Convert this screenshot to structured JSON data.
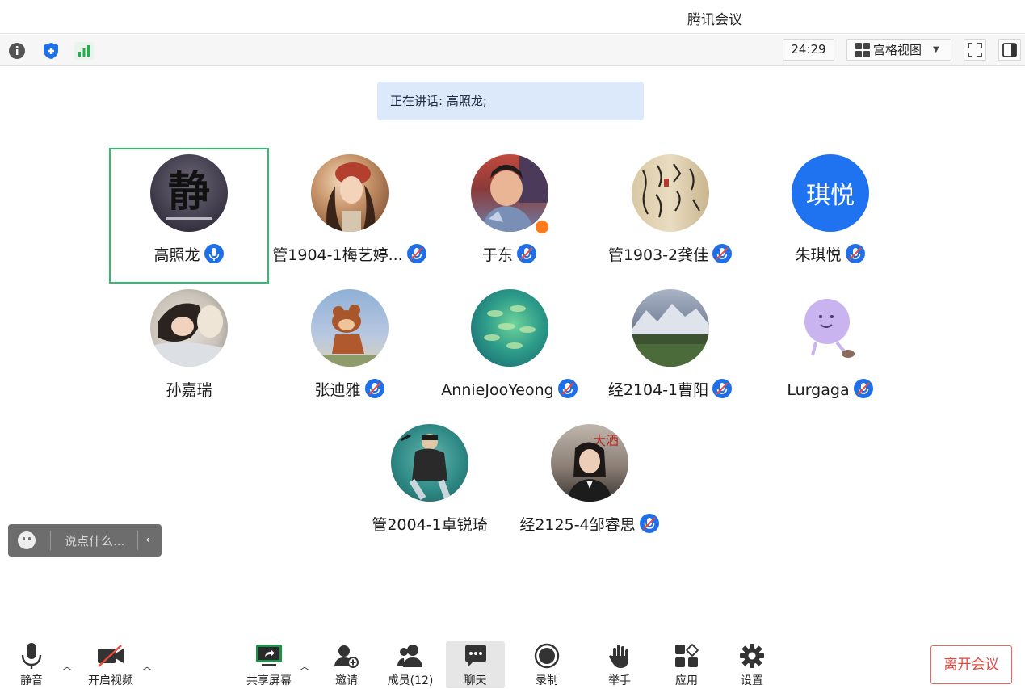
{
  "app": {
    "title": "腾讯会议"
  },
  "toolbar": {
    "timer": "24:29",
    "view_label": "宫格视图",
    "icons": [
      "info-icon",
      "shield-icon",
      "signal-icon",
      "grid-icon",
      "fullscreen-icon",
      "sidebar-icon"
    ]
  },
  "speaking": {
    "text": "正在讲话: 高照龙;"
  },
  "participants": [
    {
      "name": "高照龙",
      "mic": "active"
    },
    {
      "name": "管1904-1梅艺婷...",
      "mic": "muted"
    },
    {
      "name": "于东",
      "mic": "muted",
      "host": true
    },
    {
      "name": "管1903-2龚佳",
      "mic": "muted"
    },
    {
      "name": "朱琪悦",
      "mic": "muted",
      "avatar_text": "琪悦"
    },
    {
      "name": "孙嘉瑞",
      "mic": "none"
    },
    {
      "name": "张迪雅",
      "mic": "muted"
    },
    {
      "name": "AnnieJooYeong",
      "mic": "muted"
    },
    {
      "name": "经2104-1曹阳",
      "mic": "muted"
    },
    {
      "name": "Lurgaga",
      "mic": "muted"
    },
    {
      "name": "管2004-1卓锐琦",
      "mic": "none"
    },
    {
      "name": "经2125-4邹睿思",
      "mic": "muted"
    }
  ],
  "chat": {
    "placeholder": "说点什么..."
  },
  "bottom": {
    "mute": "静音",
    "video": "开启视频",
    "share": "共享屏幕",
    "invite": "邀请",
    "members": "成员(12)",
    "chat": "聊天",
    "record": "录制",
    "raise_hand": "举手",
    "apps": "应用",
    "settings": "设置",
    "leave": "离开会议"
  },
  "colors": {
    "accent": "#1f6fe8",
    "active_border": "#2fbf6a",
    "leave": "#e0473d",
    "speaking_bg": "#dbe9fb"
  }
}
